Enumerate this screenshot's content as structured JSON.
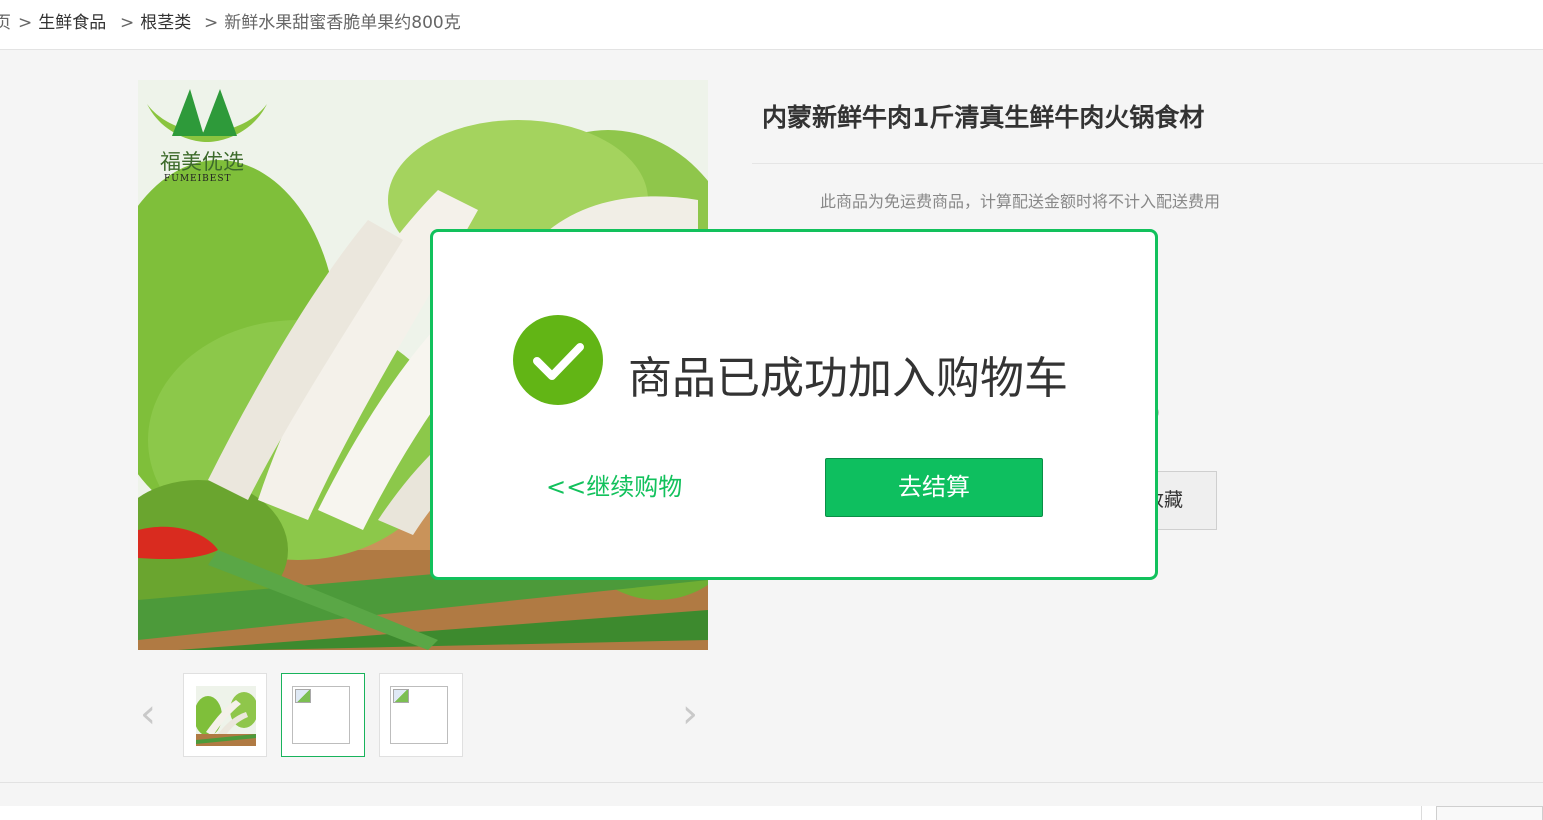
{
  "breadcrumb": {
    "items": [
      {
        "sep": ">",
        "label": "生鲜食品"
      },
      {
        "sep": ">",
        "label": "根茎类"
      },
      {
        "sep": ">",
        "label": "新鲜水果甜蜜香脆单果约800克"
      }
    ]
  },
  "product": {
    "brand_logo_text": "福美优选",
    "brand_logo_sub": "FUMEIBEST",
    "title": "内蒙新鲜牛肉1斤清真生鲜牛肉火锅食材",
    "shipping_note": "此商品为免运费商品，计算配送金额时将不计入配送费用",
    "partial_paren": " )",
    "favorite_partial": "收藏"
  },
  "gallery": {
    "prev_arrow": "‹",
    "next_arrow": "›",
    "thumbnails": [
      {
        "state": "image"
      },
      {
        "state": "broken",
        "active": true
      },
      {
        "state": "broken"
      }
    ]
  },
  "modal": {
    "message": "商品已成功加入购物车",
    "continue_label": "<<继续购物",
    "checkout_label": "去结算",
    "accent_color": "#12c15c",
    "check_color": "#62b515"
  }
}
